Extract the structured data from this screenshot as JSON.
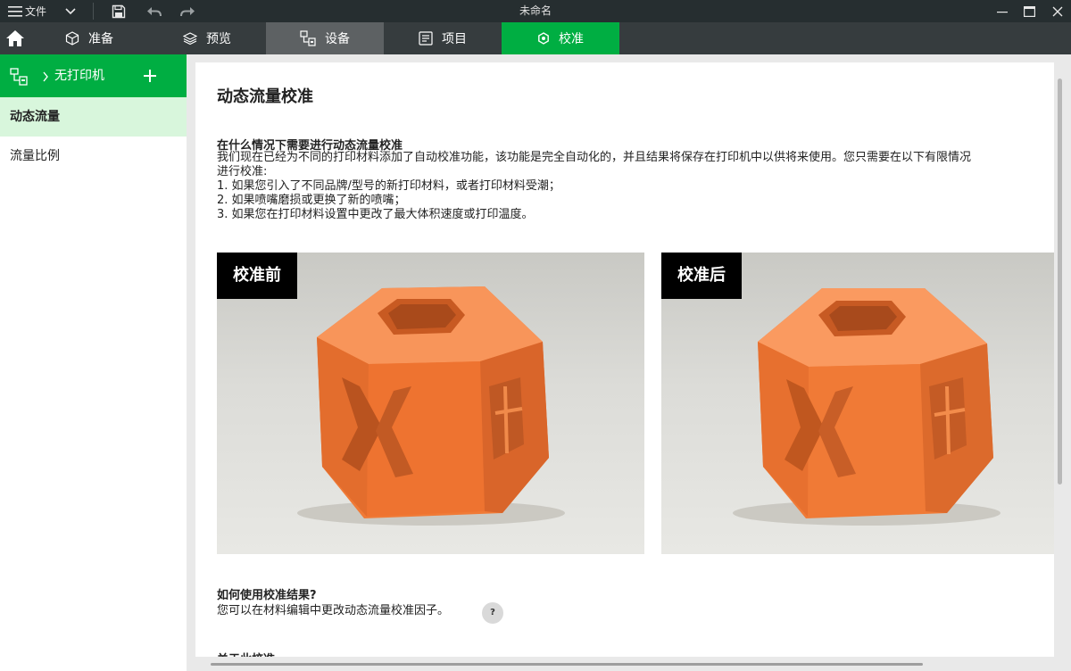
{
  "titlebar": {
    "file_label": "文件",
    "window_title": "未命名",
    "icons": [
      "menu-icon",
      "chevron-down-icon",
      "save-icon",
      "undo-icon",
      "redo-icon",
      "minimize-icon",
      "maximize-icon",
      "close-icon"
    ]
  },
  "tabs": [
    {
      "label": "准备",
      "icon": "cube-icon"
    },
    {
      "label": "预览",
      "icon": "layers-icon"
    },
    {
      "label": "设备",
      "icon": "device-icon"
    },
    {
      "label": "项目",
      "icon": "project-icon"
    },
    {
      "label": "校准",
      "icon": "calibration-icon"
    }
  ],
  "active_tab": "校准",
  "sidebar": {
    "printer_label": "无打印机",
    "items": [
      {
        "label": "动态流量",
        "active": true
      },
      {
        "label": "流量比例",
        "active": false
      }
    ]
  },
  "content": {
    "title": "动态流量校准",
    "section1_heading": "在什么情况下需要进行动态流量校准",
    "section1_lines": [
      "我们现在已经为不同的打印材料添加了自动校准功能，该功能是完全自动化的，并且结果将保存在打印机中以供将来使用。您只需要在以下有限情况",
      "进行校准:",
      "1. 如果您引入了不同品牌/型号的新打印材料，或者打印材料受潮；",
      "2. 如果喷嘴磨损或更换了新的喷嘴；",
      "3. 如果您在打印材料设置中更改了最大体积速度或打印温度。"
    ],
    "before_label": "校准前",
    "after_label": "校准后",
    "section2_heading": "如何使用校准结果?",
    "section2_text": "您可以在材料编辑中更改动态流量校准因子。",
    "help_label": "?",
    "section3_heading_partial": "关于此校准"
  },
  "colors": {
    "brand_green": "#00ae42",
    "active_item_bg": "#d8f6dc",
    "titlebar_bg": "#262e30",
    "tabbar_bg": "#363c3e",
    "filament_orange": "#f07a36"
  }
}
